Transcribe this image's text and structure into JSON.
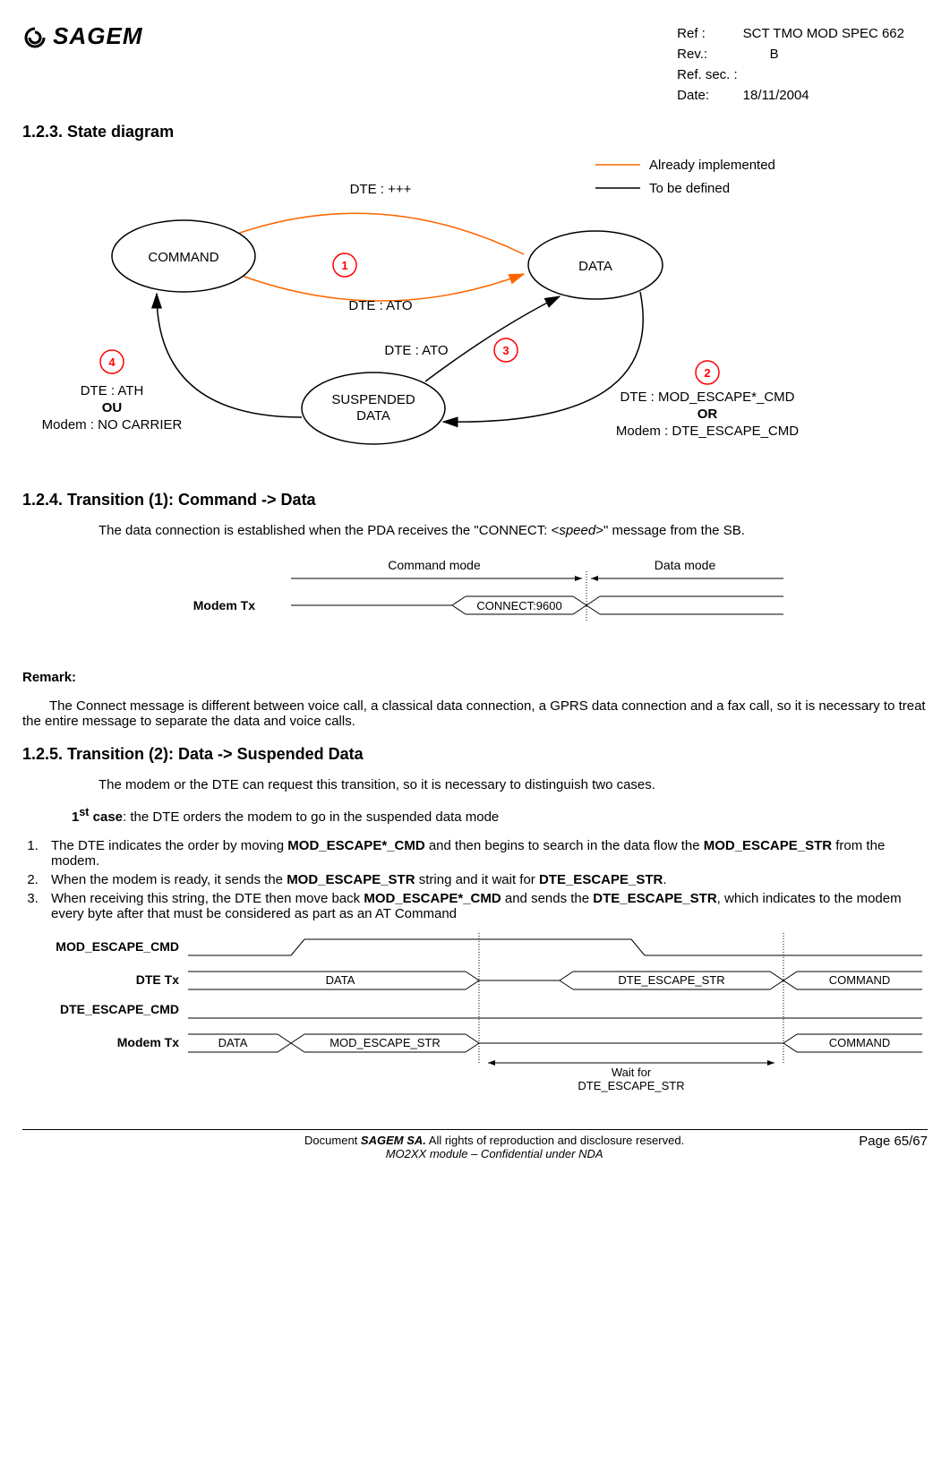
{
  "header": {
    "brand": "SAGEM",
    "ref_label": "Ref :",
    "ref_value": "SCT TMO MOD SPEC 662",
    "rev_label": "Rev.:",
    "rev_value": "B",
    "refsec_label": "Ref. sec. :",
    "refsec_value": "",
    "date_label": "Date:",
    "date_value": "18/11/2004"
  },
  "section_123": {
    "heading": "1.2.3.  State diagram",
    "legend": {
      "already": "Already implemented",
      "tobe": "To be defined"
    },
    "diagram": {
      "state_command": "COMMAND",
      "state_data": "DATA",
      "state_suspended_l1": "SUSPENDED",
      "state_suspended_l2": "DATA",
      "label_top": "DTE : +++",
      "label_mid": "DTE : ATO",
      "label_susp_ato": "DTE : ATO",
      "circle1": "1",
      "circle2": "2",
      "circle3": "3",
      "circle4": "4",
      "left_l1": "DTE : ATH",
      "left_l2": "OU",
      "left_l3": "Modem : NO CARRIER",
      "right_l1": "DTE : MOD_ESCAPE*_CMD",
      "right_l2": "OR",
      "right_l3": "Modem : DTE_ESCAPE_CMD"
    }
  },
  "section_124": {
    "heading": "1.2.4.  Transition (1): Command -> Data",
    "para_pre": "The data connection is established when the PDA receives the \"CONNECT: <",
    "para_speed": "speed",
    "para_post": ">\" message from the SB.",
    "timing": {
      "cmd_mode": "Command mode",
      "data_mode": "Data mode",
      "modem_tx": "Modem Tx",
      "connect": "CONNECT:9600"
    },
    "remark_title": "Remark:",
    "remark_body": "The Connect message is different between voice call, a classical data connection, a GPRS data connection and a fax call, so it is necessary to treat the entire message to separate the data and voice calls."
  },
  "section_125": {
    "heading": "1.2.5.  Transition (2): Data -> Suspended Data",
    "intro": "The modem or the DTE can request this transition, so it is necessary to distinguish two cases.",
    "case1_label_pre": "1",
    "case1_label_post": " case",
    "case1_rest": ": the DTE orders the modem to go in the suspended data mode",
    "step1_a": "The DTE indicates the order by moving ",
    "step1_b": "MOD_ESCAPE*_CMD",
    "step1_c": " and then begins to search in the data flow the ",
    "step1_d": "MOD_ESCAPE_STR",
    "step1_e": " from the modem.",
    "step2_a": "When the modem is ready, it sends the ",
    "step2_b": "MOD_ESCAPE_STR",
    "step2_c": " string and it wait for ",
    "step2_d": "DTE_ESCAPE_STR",
    "step2_e": ".",
    "step3_a": "When receiving this string, the DTE then move back ",
    "step3_b": "MOD_ESCAPE*_CMD",
    "step3_c": " and sends the ",
    "step3_d": "DTE_ESCAPE_STR",
    "step3_e": ", which indicates to the modem every byte after that must be considered as part as an AT Command",
    "timing": {
      "mod_escape_cmd": "MOD_ESCAPE_CMD",
      "dte_tx": "DTE Tx",
      "dte_escape_cmd": "DTE_ESCAPE_CMD",
      "modem_tx": "Modem Tx",
      "data": "DATA",
      "dte_escape_str": "DTE_ESCAPE_STR",
      "command": "COMMAND",
      "mod_escape_str": "MOD_ESCAPE_STR",
      "wait_l1": "Wait for",
      "wait_l2": "DTE_ESCAPE_STR"
    }
  },
  "footer": {
    "center_l1_pre": "Document ",
    "center_l1_brand": "SAGEM SA.",
    "center_l1_post": "  All rights of reproduction and disclosure reserved.",
    "center_l2": "MO2XX module – Confidential under NDA",
    "page": "Page 65/67"
  },
  "chart_data": {
    "type": "state-diagram",
    "states": [
      "COMMAND",
      "DATA",
      "SUSPENDED DATA"
    ],
    "transitions": [
      {
        "id": 1,
        "from": "COMMAND",
        "to": "DATA",
        "label": "DTE : ATO",
        "status": "Already implemented"
      },
      {
        "id": null,
        "from": "DATA",
        "to": "COMMAND",
        "label": "DTE : +++",
        "status": "Already implemented"
      },
      {
        "id": 2,
        "from": "DATA",
        "to": "SUSPENDED DATA",
        "label": "DTE : MOD_ESCAPE*_CMD OR Modem : DTE_ESCAPE_CMD",
        "status": "To be defined"
      },
      {
        "id": 3,
        "from": "SUSPENDED DATA",
        "to": "DATA",
        "label": "DTE : ATO",
        "status": "To be defined"
      },
      {
        "id": 4,
        "from": "SUSPENDED DATA",
        "to": "COMMAND",
        "label": "DTE : ATH OU Modem : NO CARRIER",
        "status": "To be defined"
      }
    ],
    "legend": {
      "orange": "Already implemented",
      "black": "To be defined"
    }
  }
}
